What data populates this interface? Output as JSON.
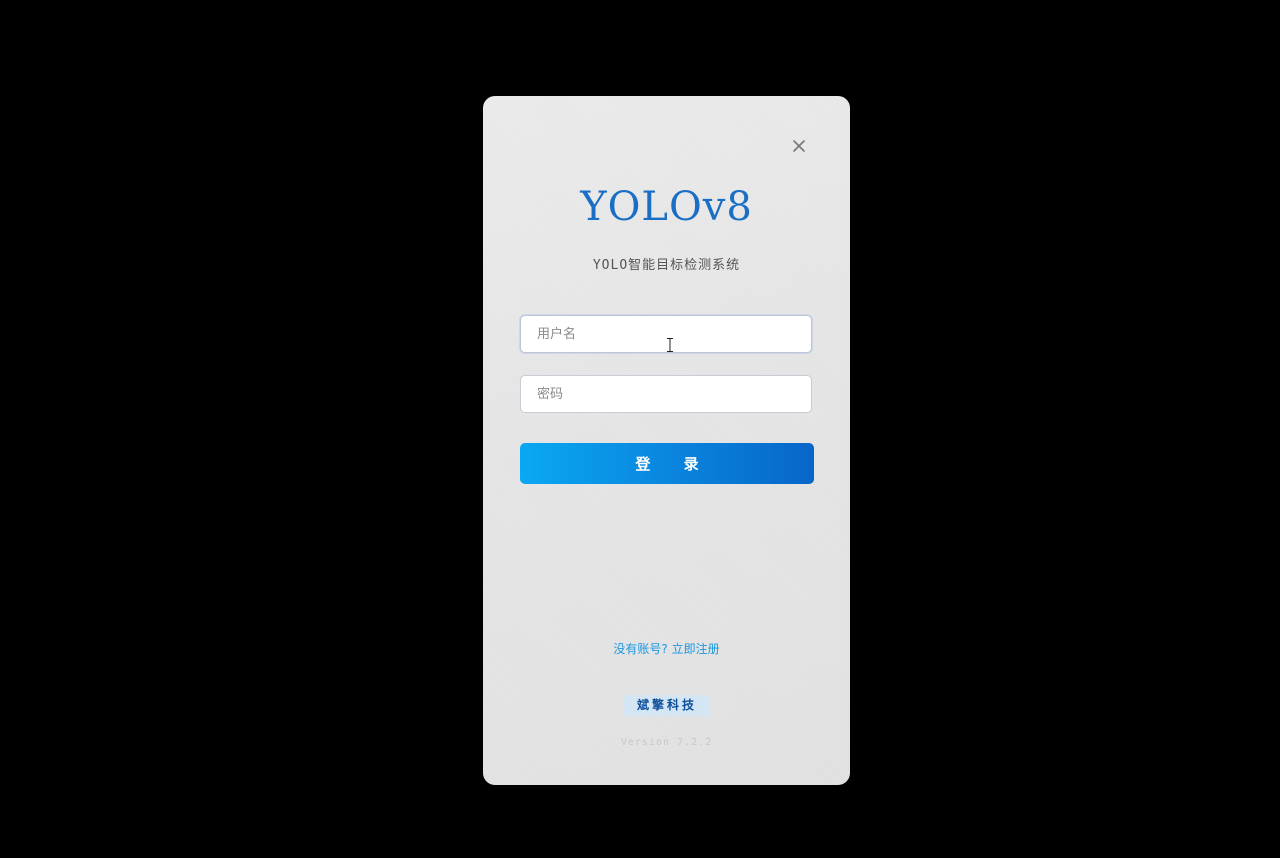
{
  "dialog": {
    "close_icon": "close-icon",
    "title": "YOLOv8",
    "subtitle": "YOLO智能目标检测系统",
    "username": {
      "value": "",
      "placeholder": "用户名"
    },
    "password": {
      "value": "",
      "placeholder": "密码"
    },
    "login_label": "登 录",
    "register_link": "没有账号? 立即注册",
    "brand": "斌擎科技",
    "version": "Version 7.2.2"
  },
  "colors": {
    "background": "#000000",
    "title": "#1a6fc4",
    "button_start": "#0aa8f2",
    "button_end": "#0766c9",
    "link": "#1a98e0",
    "badge_bg": "#d4e6f4",
    "badge_text": "#0f4f9a"
  }
}
